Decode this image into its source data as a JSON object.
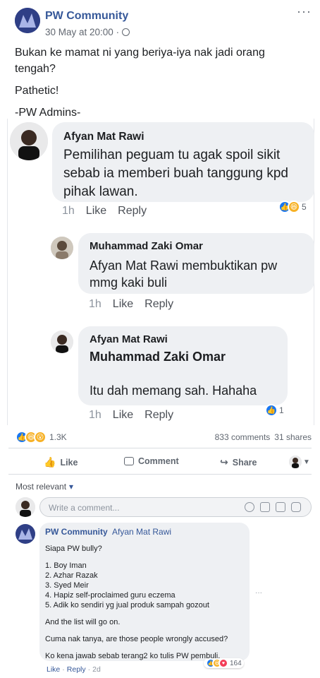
{
  "post": {
    "page_name": "PW Community",
    "date": "30 May at 20:00 ·",
    "body_lines": [
      "Bukan ke mamat ni yang beriya-iya nak jadi orang",
      "tengah?",
      "Pathetic!",
      "-PW Admins-"
    ],
    "more": "···"
  },
  "comment1": {
    "author": "Afyan Mat Rawi",
    "text_lines": [
      "Pemilihan peguam tu agak spoil sikit",
      "sebab ia memberi buah tanggung kpd",
      "pihak lawan."
    ],
    "time": "1h",
    "like": "Like",
    "reply": "Reply",
    "reaction_count": "5"
  },
  "reply1": {
    "author": "Muhammad Zaki Omar",
    "text_lines": [
      "Afyan Mat Rawi membuktikan pw",
      "mmg kaki buli"
    ],
    "time": "1h",
    "like": "Like",
    "reply": "Reply"
  },
  "reply2": {
    "author": "Afyan Mat Rawi",
    "mention": "Muhammad Zaki Omar",
    "text": "Itu dah memang sah. Hahaha",
    "time": "1h",
    "like": "Like",
    "reply": "Reply",
    "reaction_count": "1"
  },
  "stats": {
    "reactions": "1.3K",
    "comments": "833 comments",
    "shares": "31 shares"
  },
  "actions": {
    "like": "Like",
    "comment": "Comment",
    "share": "Share"
  },
  "sort": {
    "label": "Most relevant",
    "caret": "▾"
  },
  "input": {
    "placeholder": "Write a comment..."
  },
  "page_reply": {
    "author": "PW Community",
    "mention": "Afyan Mat Rawi",
    "lines": [
      "Siapa PW bully?",
      "1. Boy Iman",
      "2. Azhar Razak",
      "3. Syed Meir",
      "4. Hapiz self-proclaimed guru eczema",
      "5. Adik ko sendiri yg jual produk sampah gozout",
      "And the list will go on.",
      "Cuma nak tanya, are those people wrongly accused?",
      "Ko kena jawab sebab terang2 ko tulis PW pembuli."
    ],
    "like": "Like",
    "reply": "Reply",
    "time": "2d",
    "sep": "·",
    "reaction_count": "164",
    "more": "···"
  },
  "colors": {
    "link": "#365899",
    "accent": "#1877f2",
    "bubble": "#eef0f3"
  }
}
